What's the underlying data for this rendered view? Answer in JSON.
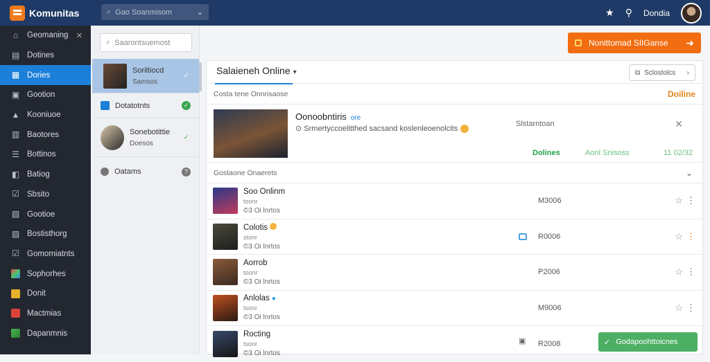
{
  "app": {
    "name": "Komunitas"
  },
  "search": {
    "placeholder": "Gao Soanmisom"
  },
  "top": {
    "user": "Dondia"
  },
  "sidebar": {
    "items": [
      {
        "label": "Geomaning",
        "icon": "home-icon",
        "caret": "✕"
      },
      {
        "label": "Dotines",
        "icon": "folder-icon"
      },
      {
        "label": "Dories",
        "icon": "grid-icon",
        "active": true
      },
      {
        "label": "Gootion",
        "icon": "chat-icon"
      },
      {
        "label": "Kooniuoe",
        "icon": "alert-icon"
      },
      {
        "label": "Baotores",
        "icon": "calendar-icon"
      },
      {
        "label": "Bottinos",
        "icon": "list-icon"
      },
      {
        "label": "Batiog",
        "icon": "tag-icon"
      },
      {
        "label": "Sbsito",
        "icon": "check-icon"
      },
      {
        "label": "Gootioe",
        "icon": "doc-icon"
      },
      {
        "label": "Bostisthorg",
        "icon": "people-icon"
      },
      {
        "label": "Gomomiatnts",
        "icon": "check-icon"
      },
      {
        "label": "Sophorhes",
        "icon": "gem-icon"
      },
      {
        "label": "Donit",
        "icon": "trophy-icon"
      },
      {
        "label": "Mactmias",
        "icon": "star-icon"
      },
      {
        "label": "Dapanmnis",
        "icon": "puzzle-icon"
      }
    ]
  },
  "listpane": {
    "search_placeholder": "Saarontsuemost",
    "items": [
      {
        "name": "Soriltiocd",
        "sub": "Samsos",
        "badge": "✓"
      },
      {
        "name": "Dotatotnts",
        "sub": "",
        "badge": "✓"
      },
      {
        "name": "Sonebotittie",
        "sub": "Doesos",
        "badge": "✓"
      },
      {
        "name": "Oatams",
        "sub": "",
        "badge": "?"
      }
    ]
  },
  "cta": {
    "label": "Nonittomad SIIGanse"
  },
  "card": {
    "title": "Salaieneh Online",
    "filter": "Sclostolcs",
    "section1": {
      "label": "Costa tene Onnrisaose",
      "right": "Doiline"
    },
    "featured": {
      "title": "Oonoobntiris",
      "tag": "ore",
      "desc": "Srmertyccoelitthed sacsand koslenleoenolcits",
      "status": "Slstarntoan",
      "g1": "Dolines",
      "g2": "Aonl Snisoss",
      "g3": "11 02/32"
    },
    "section2": {
      "label": "Gostaone Onaerets"
    },
    "rows": [
      {
        "name": "Soo Onlinm",
        "sub": "toonr",
        "meta": "©3 Oi lnrtos",
        "value": "M3006"
      },
      {
        "name": "Colotis",
        "sub": "stonr",
        "meta": "©3 Oi lnrtos",
        "value": "R0006"
      },
      {
        "name": "Aorrob",
        "sub": "toonr",
        "meta": "©3 Oi lnrtos",
        "value": "P2006"
      },
      {
        "name": "Anlolas",
        "sub": "tsonr",
        "meta": "©3 Oi lnrtos",
        "value": "M9006"
      },
      {
        "name": "Rocting",
        "sub": "tsonr",
        "meta": "©3 Oi lnrtos",
        "value": "R2008"
      }
    ]
  },
  "toast": {
    "label": "Godapoohttoicnes"
  },
  "colors": {
    "topbar": "#1f3a66",
    "accent": "#1c7fd8",
    "cta": "#f26d11",
    "success": "#4caf63"
  }
}
